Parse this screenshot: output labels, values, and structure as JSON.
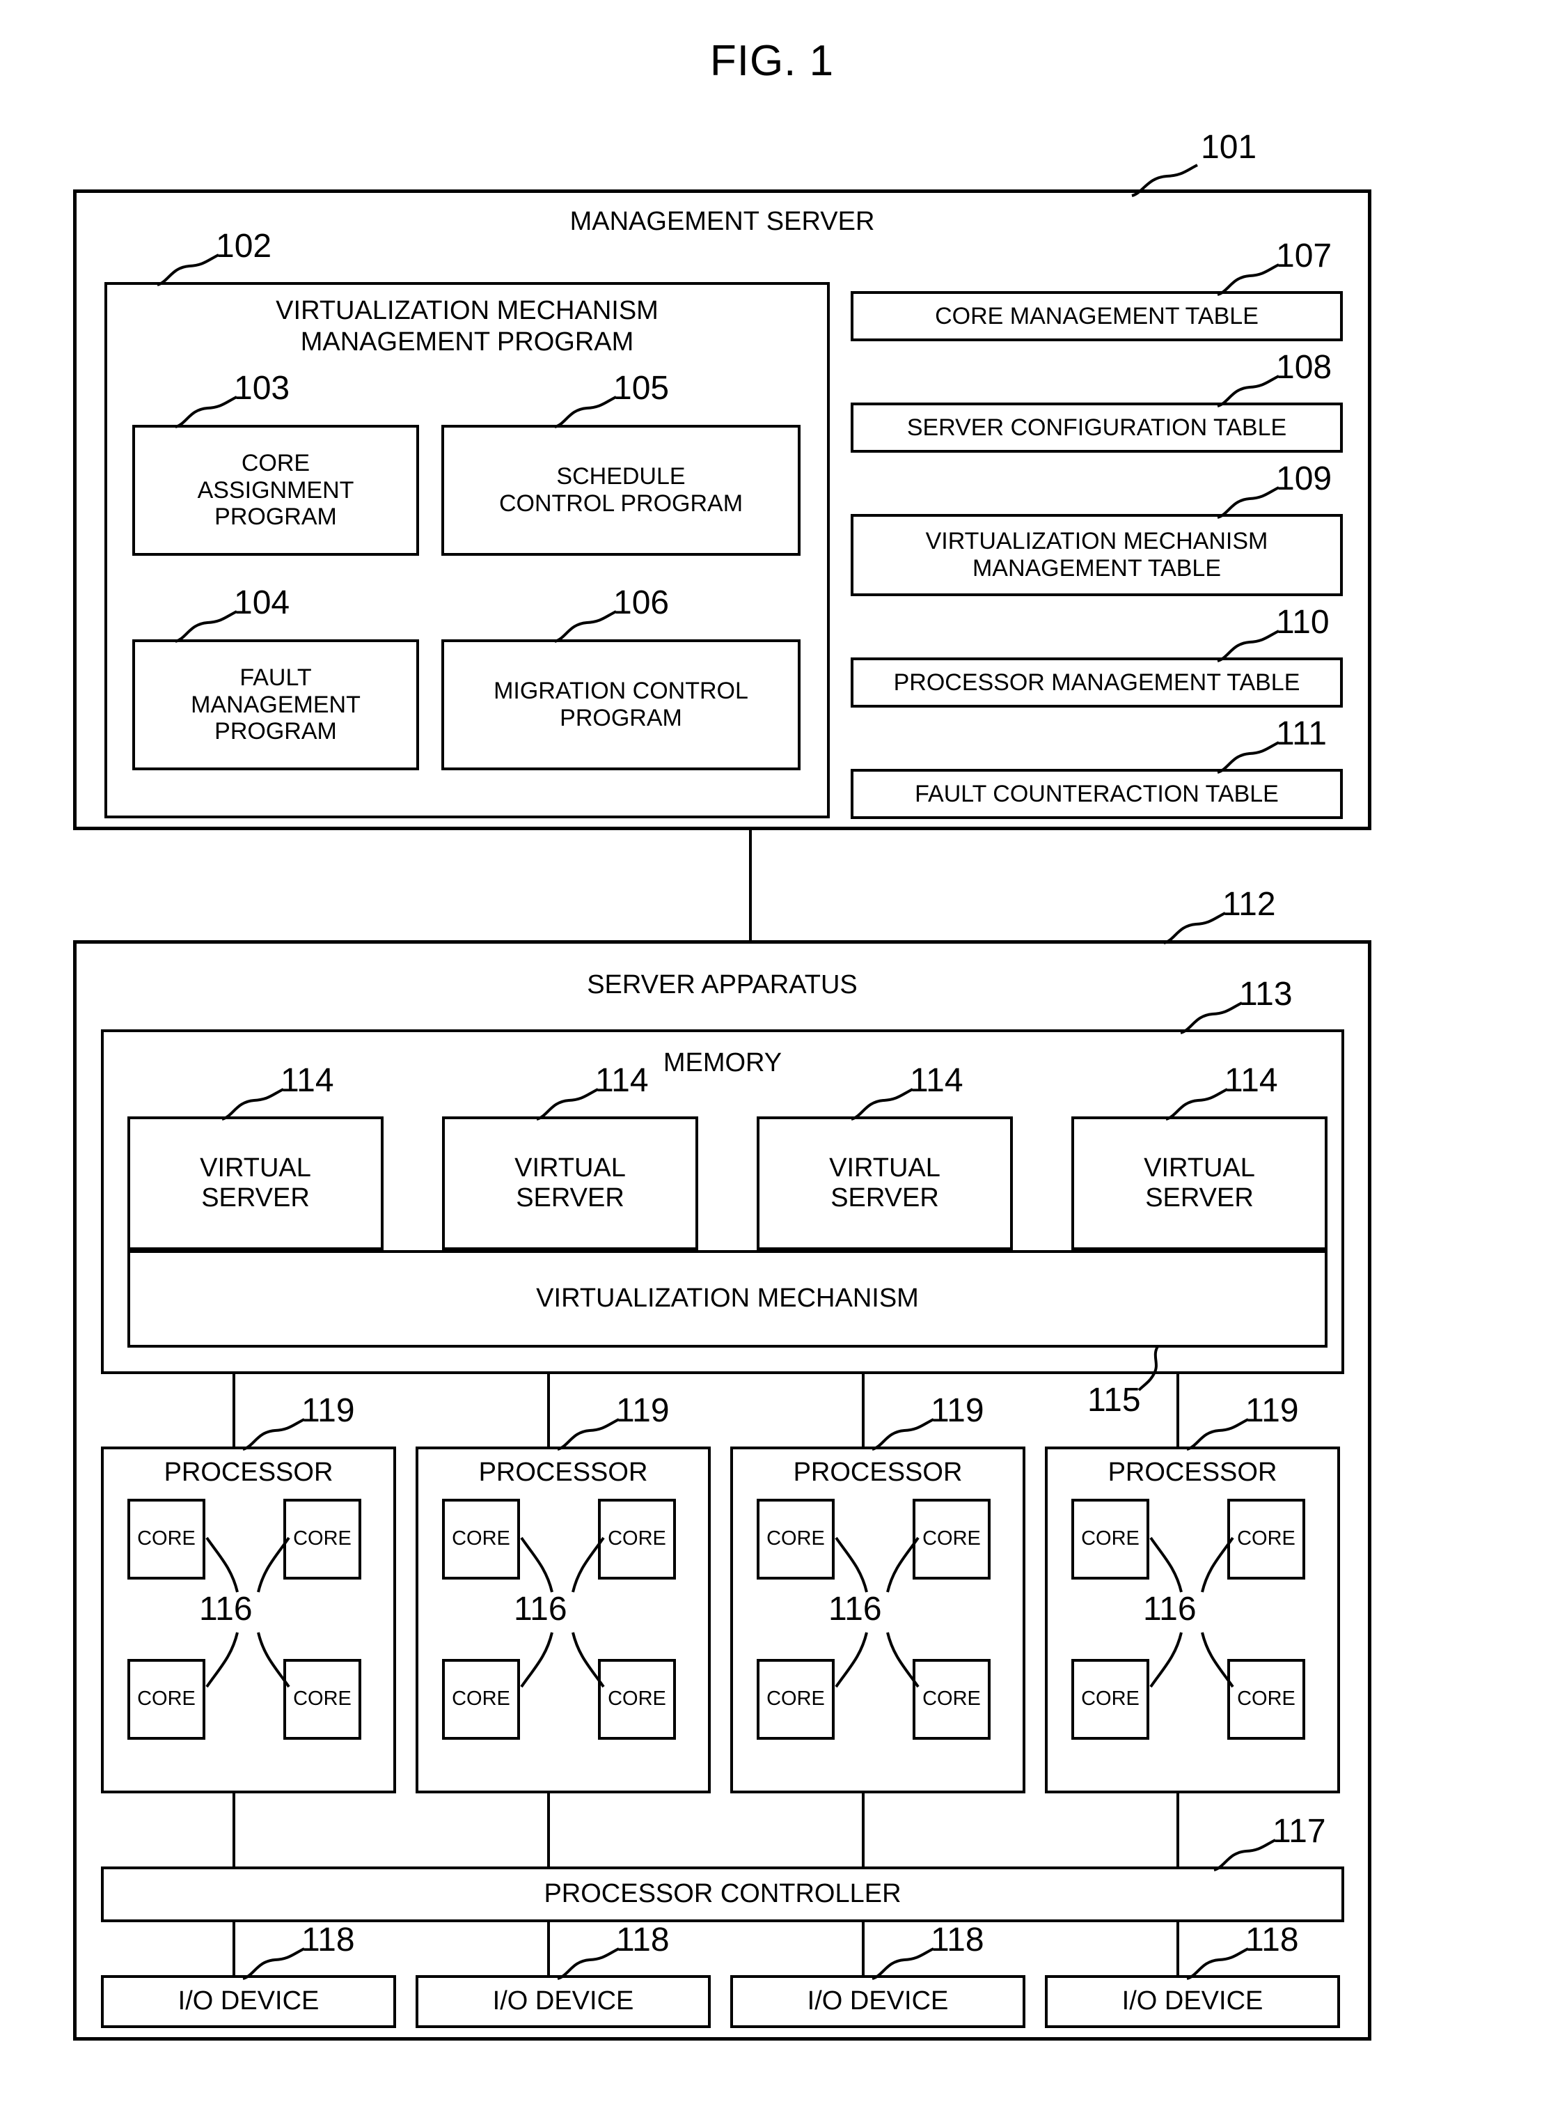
{
  "figure": {
    "title": "FIG. 1"
  },
  "management_server": {
    "ref": "101",
    "title": "MANAGEMENT SERVER",
    "program_block": {
      "ref": "102",
      "title_line1": "VIRTUALIZATION MECHANISM",
      "title_line2": "MANAGEMENT PROGRAM",
      "programs": [
        {
          "ref": "103",
          "label": "CORE\nASSIGNMENT\nPROGRAM"
        },
        {
          "ref": "105",
          "label": "SCHEDULE\nCONTROL PROGRAM"
        },
        {
          "ref": "104",
          "label": "FAULT\nMANAGEMENT\nPROGRAM"
        },
        {
          "ref": "106",
          "label": "MIGRATION CONTROL\nPROGRAM"
        }
      ]
    },
    "tables": [
      {
        "ref": "107",
        "label": "CORE MANAGEMENT TABLE"
      },
      {
        "ref": "108",
        "label": "SERVER CONFIGURATION TABLE"
      },
      {
        "ref": "109",
        "label": "VIRTUALIZATION MECHANISM\nMANAGEMENT TABLE"
      },
      {
        "ref": "110",
        "label": "PROCESSOR MANAGEMENT TABLE"
      },
      {
        "ref": "111",
        "label": "FAULT COUNTERACTION TABLE"
      }
    ]
  },
  "server_apparatus": {
    "ref": "112",
    "title": "SERVER APPARATUS",
    "memory": {
      "ref": "113",
      "title": "MEMORY",
      "virtual_servers": [
        {
          "ref": "114",
          "label": "VIRTUAL\nSERVER"
        },
        {
          "ref": "114",
          "label": "VIRTUAL\nSERVER"
        },
        {
          "ref": "114",
          "label": "VIRTUAL\nSERVER"
        },
        {
          "ref": "114",
          "label": "VIRTUAL\nSERVER"
        }
      ],
      "virtualization_mechanism": {
        "ref": "115",
        "label": "VIRTUALIZATION MECHANISM"
      }
    },
    "processors": [
      {
        "ref": "119",
        "label": "PROCESSOR",
        "core_ref": "116",
        "cores": [
          "CORE",
          "CORE",
          "CORE",
          "CORE"
        ]
      },
      {
        "ref": "119",
        "label": "PROCESSOR",
        "core_ref": "116",
        "cores": [
          "CORE",
          "CORE",
          "CORE",
          "CORE"
        ]
      },
      {
        "ref": "119",
        "label": "PROCESSOR",
        "core_ref": "116",
        "cores": [
          "CORE",
          "CORE",
          "CORE",
          "CORE"
        ]
      },
      {
        "ref": "119",
        "label": "PROCESSOR",
        "core_ref": "116",
        "cores": [
          "CORE",
          "CORE",
          "CORE",
          "CORE"
        ]
      }
    ],
    "processor_controller": {
      "ref": "117",
      "label": "PROCESSOR CONTROLLER"
    },
    "io_devices": [
      {
        "ref": "118",
        "label": "I/O DEVICE"
      },
      {
        "ref": "118",
        "label": "I/O DEVICE"
      },
      {
        "ref": "118",
        "label": "I/O DEVICE"
      },
      {
        "ref": "118",
        "label": "I/O DEVICE"
      }
    ]
  }
}
